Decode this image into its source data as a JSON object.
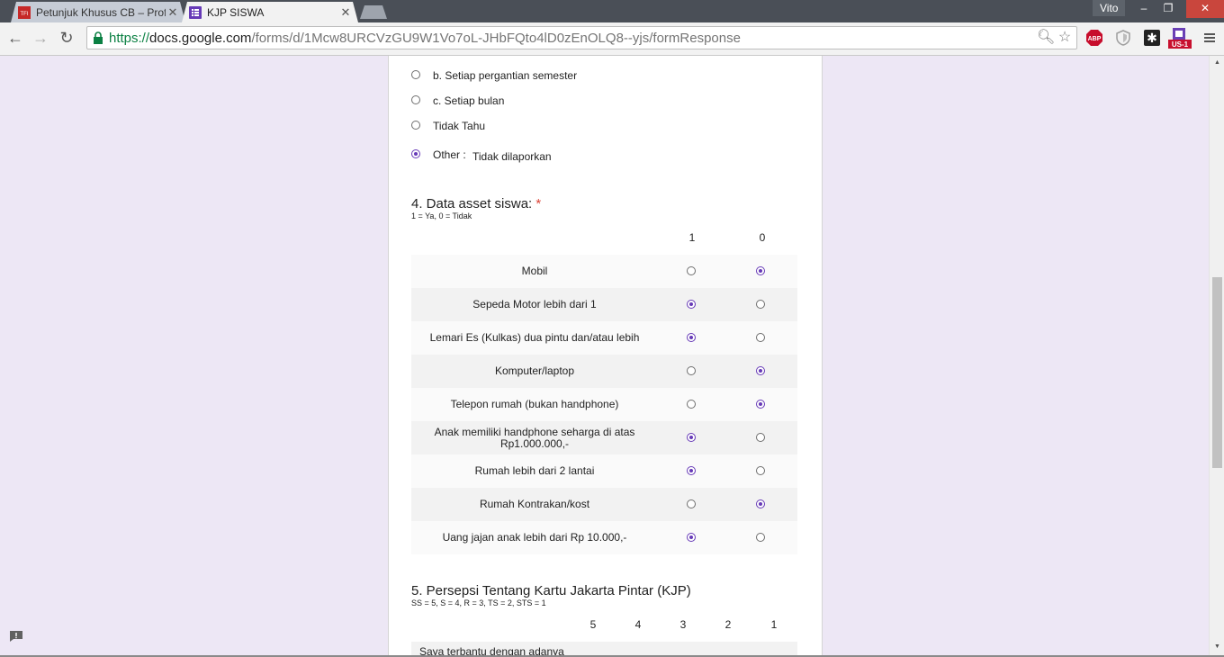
{
  "browser": {
    "tabs": [
      {
        "label": "Petunjuk Khusus CB – Prof",
        "favicon": "TFI",
        "active": false
      },
      {
        "label": "KJP SISWA",
        "active": true
      }
    ],
    "user": "Vito",
    "url": {
      "scheme": "https://",
      "host": "docs.google.com",
      "path": "/forms/d/1Mcw8URCVzGU9W1Vo7oL-JHbFQto4lD0zEnOLQ8--yjs/formResponse"
    },
    "extensions": [
      "abp-icon",
      "shield-icon",
      "puzzle-icon",
      "translate-us1-icon"
    ],
    "ext_labels": {
      "abp": "ABP",
      "us1": "US-1"
    }
  },
  "form": {
    "q3": {
      "options": [
        {
          "label": "b. Setiap pergantian semester",
          "checked": false
        },
        {
          "label": "c. Setiap bulan",
          "checked": false
        },
        {
          "label": "Tidak Tahu",
          "checked": false
        }
      ],
      "other_label": "Other :",
      "other_value": "Tidak dilaporkan",
      "other_checked": true
    },
    "q4": {
      "title": "4. Data asset siswa:",
      "required_mark": "*",
      "help": "1 = Ya, 0 = Tidak",
      "columns": [
        "1",
        "0"
      ],
      "rows": [
        {
          "label": "Mobil",
          "selected": "0"
        },
        {
          "label": "Sepeda Motor lebih dari 1",
          "selected": "1"
        },
        {
          "label": "Lemari Es (Kulkas) dua pintu dan/atau lebih",
          "selected": "1"
        },
        {
          "label": "Komputer/laptop",
          "selected": "0"
        },
        {
          "label": "Telepon rumah (bukan handphone)",
          "selected": "0"
        },
        {
          "label": "Anak memiliki handphone seharga di atas Rp1.000.000,-",
          "selected": "1"
        },
        {
          "label": "Rumah lebih dari 2 lantai",
          "selected": "1"
        },
        {
          "label": "Rumah Kontrakan/kost",
          "selected": "0"
        },
        {
          "label": "Uang jajan anak lebih dari Rp 10.000,-",
          "selected": "1"
        }
      ]
    },
    "q5": {
      "title": "5. Persepsi Tentang Kartu Jakarta Pintar (KJP)",
      "help": "SS = 5, S = 4, R = 3, TS = 2, STS = 1",
      "columns": [
        "5",
        "4",
        "3",
        "2",
        "1"
      ],
      "first_row_label": "Saya terbantu dengan adanya"
    }
  },
  "colors": {
    "accent": "#673ab7",
    "background": "#ede7f5",
    "required": "#db4437",
    "url_scheme": "#0b8043"
  }
}
